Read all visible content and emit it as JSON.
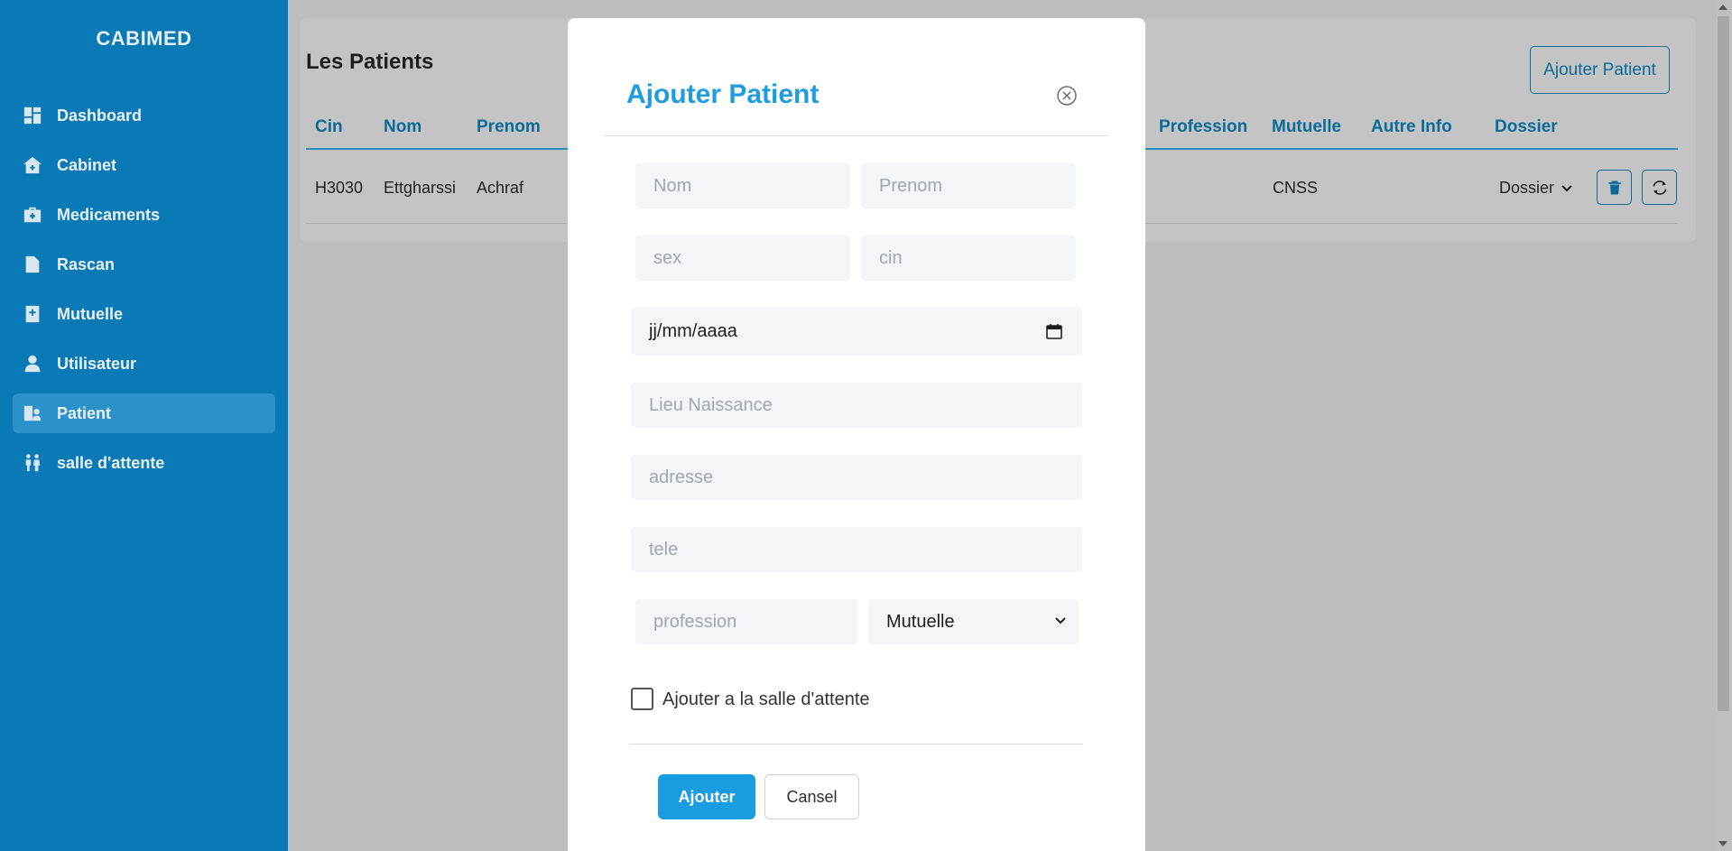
{
  "sidebar": {
    "brand": "CABIMED",
    "items": [
      {
        "label": "Dashboard",
        "icon": "dashboard-icon"
      },
      {
        "label": "Cabinet",
        "icon": "home-plus-icon"
      },
      {
        "label": "Medicaments",
        "icon": "medkit-icon"
      },
      {
        "label": "Rascan",
        "icon": "file-pulse-icon"
      },
      {
        "label": "Mutuelle",
        "icon": "book-plus-icon"
      },
      {
        "label": "Utilisateur",
        "icon": "user-doctor-icon"
      },
      {
        "label": "Patient",
        "icon": "hospital-user-icon",
        "active": true
      },
      {
        "label": "salle d'attente",
        "icon": "people-icon"
      }
    ]
  },
  "main": {
    "title": "Les Patients",
    "add_button": "Ajouter Patient",
    "table": {
      "headers": {
        "cin": "Cin",
        "nom": "Nom",
        "prenom": "Prenom",
        "profession": "Profession",
        "mutuelle": "Mutuelle",
        "autre_info": "Autre Info",
        "dossier": "Dossier"
      },
      "rows": [
        {
          "cin": "H3030",
          "nom": "Ettgharssi",
          "prenom": "Achraf",
          "mutuelle": "CNSS",
          "dossier": "Dossier"
        }
      ]
    }
  },
  "modal": {
    "title": "Ajouter Patient",
    "fields": {
      "nom_placeholder": "Nom",
      "prenom_placeholder": "Prenom",
      "sex_placeholder": "sex",
      "cin_placeholder": "cin",
      "date_value": "jj/mm/aaaa",
      "lieu_placeholder": "Lieu Naissance",
      "adresse_placeholder": "adresse",
      "tele_placeholder": "tele",
      "profession_placeholder": "profession",
      "mutuelle_selected": "Mutuelle"
    },
    "checkbox_label": "Ajouter a la salle d'attente",
    "submit": "Ajouter",
    "cancel": "Cansel"
  },
  "colors": {
    "sidebar": "#0a7ab6",
    "accent": "#1a9de0",
    "table_header": "#0b6b99"
  }
}
